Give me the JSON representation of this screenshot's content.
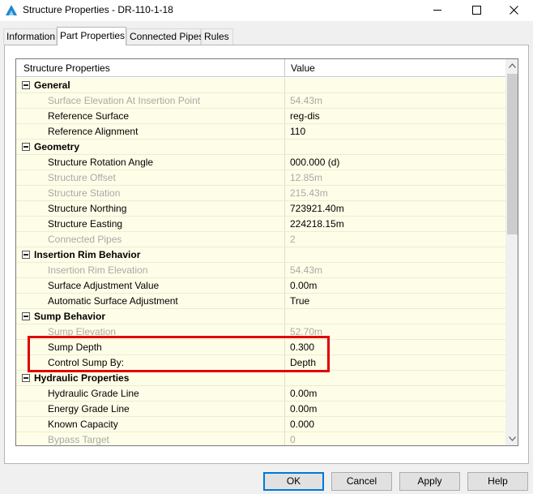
{
  "window": {
    "title": "Structure Properties - DR-110-1-18"
  },
  "tabs": [
    {
      "label": "Information"
    },
    {
      "label": "Part Properties"
    },
    {
      "label": "Connected Pipes"
    },
    {
      "label": "Rules"
    }
  ],
  "active_tab": "Part Properties",
  "grid": {
    "header_property": "Structure Properties",
    "header_value": "Value",
    "rows": [
      {
        "type": "category",
        "name": "General"
      },
      {
        "type": "readonly",
        "name": "Surface Elevation At Insertion Point",
        "value": "54.43m"
      },
      {
        "type": "editable",
        "name": "Reference Surface",
        "value": "reg-dis"
      },
      {
        "type": "editable",
        "name": "Reference Alignment",
        "value": "110"
      },
      {
        "type": "category",
        "name": "Geometry"
      },
      {
        "type": "editable",
        "name": "Structure Rotation Angle",
        "value": "000.000 (d)"
      },
      {
        "type": "readonly",
        "name": "Structure Offset",
        "value": "12.85m"
      },
      {
        "type": "readonly",
        "name": "Structure Station",
        "value": "215.43m"
      },
      {
        "type": "editable",
        "name": "Structure Northing",
        "value": "723921.40m"
      },
      {
        "type": "editable",
        "name": "Structure Easting",
        "value": "224218.15m"
      },
      {
        "type": "readonly",
        "name": "Connected Pipes",
        "value": "2"
      },
      {
        "type": "category",
        "name": "Insertion Rim Behavior"
      },
      {
        "type": "readonly",
        "name": "Insertion Rim Elevation",
        "value": "54.43m"
      },
      {
        "type": "editable",
        "name": "Surface Adjustment Value",
        "value": "0.00m"
      },
      {
        "type": "editable",
        "name": "Automatic Surface Adjustment",
        "value": "True"
      },
      {
        "type": "category",
        "name": "Sump Behavior"
      },
      {
        "type": "readonly",
        "name": "Sump Elevation",
        "value": "52.70m"
      },
      {
        "type": "editable",
        "name": "Sump Depth",
        "value": "0.300"
      },
      {
        "type": "editable",
        "name": "Control Sump By:",
        "value": "Depth"
      },
      {
        "type": "category",
        "name": "Hydraulic Properties"
      },
      {
        "type": "editable",
        "name": "Hydraulic Grade Line",
        "value": "0.00m"
      },
      {
        "type": "editable",
        "name": "Energy Grade Line",
        "value": "0.00m"
      },
      {
        "type": "editable",
        "name": "Known Capacity",
        "value": "0.000"
      },
      {
        "type": "readonly",
        "name": "Bypass Target",
        "value": "0"
      }
    ]
  },
  "buttons": {
    "ok": "OK",
    "cancel": "Cancel",
    "apply": "Apply",
    "help": "Help"
  },
  "icons": {
    "app": "civil3d-logo-icon",
    "minimize": "minimize-icon",
    "maximize": "maximize-icon",
    "close": "close-icon",
    "collapse": "collapse-minus-icon",
    "scroll_up": "scroll-up-arrow-icon",
    "scroll_down": "scroll-down-arrow-icon"
  },
  "colors": {
    "row_background": "#fefee8",
    "readonly_text": "#a8a8a8",
    "highlight": "#e00000",
    "default_button_border": "#0078d7"
  }
}
